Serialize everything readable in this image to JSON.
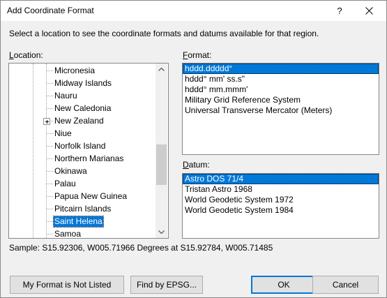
{
  "window": {
    "title": "Add Coordinate Format",
    "help_glyph": "?",
    "close_icon": "close-icon"
  },
  "instruction": "Select a location to see the coordinate formats and datums available for that region.",
  "location": {
    "label_prefix": "",
    "label_underlined": "L",
    "label_rest": "ocation:",
    "items": [
      {
        "label": "Micronesia",
        "expandable": false,
        "selected": false
      },
      {
        "label": "Midway Islands",
        "expandable": false,
        "selected": false
      },
      {
        "label": "Nauru",
        "expandable": false,
        "selected": false
      },
      {
        "label": "New Caledonia",
        "expandable": false,
        "selected": false
      },
      {
        "label": "New Zealand",
        "expandable": true,
        "selected": false
      },
      {
        "label": "Niue",
        "expandable": false,
        "selected": false
      },
      {
        "label": "Norfolk Island",
        "expandable": false,
        "selected": false
      },
      {
        "label": "Northern Marianas",
        "expandable": false,
        "selected": false
      },
      {
        "label": "Okinawa",
        "expandable": false,
        "selected": false
      },
      {
        "label": "Palau",
        "expandable": false,
        "selected": false
      },
      {
        "label": "Papua New Guinea",
        "expandable": false,
        "selected": false
      },
      {
        "label": "Pitcairn Islands",
        "expandable": false,
        "selected": false
      },
      {
        "label": "Saint Helena",
        "expandable": false,
        "selected": true
      },
      {
        "label": "Samoa",
        "expandable": false,
        "selected": false
      }
    ]
  },
  "format": {
    "label_underlined": "F",
    "label_rest": "ormat:",
    "items": [
      {
        "label": "hddd.ddddd°",
        "selected": true
      },
      {
        "label": "hddd° mm' ss.s\"",
        "selected": false
      },
      {
        "label": "hddd° mm.mmm'",
        "selected": false
      },
      {
        "label": "Military Grid Reference System",
        "selected": false
      },
      {
        "label": "Universal Transverse Mercator (Meters)",
        "selected": false
      }
    ]
  },
  "datum": {
    "label_underlined": "D",
    "label_rest": "atum:",
    "items": [
      {
        "label": "Astro DOS 71/4",
        "selected": true
      },
      {
        "label": "Tristan Astro 1968",
        "selected": false
      },
      {
        "label": "World Geodetic System 1972",
        "selected": false
      },
      {
        "label": "World Geodetic System 1984",
        "selected": false
      }
    ]
  },
  "sample": "Sample: S15.92306, W005.71966 Degrees at S15.92784, W005.71485",
  "buttons": {
    "not_listed": "My Format is Not Listed",
    "find_epsg": "Find by EPSG...",
    "ok": "OK",
    "cancel": "Cancel"
  },
  "colors": {
    "selection": "#0078d7",
    "dialog_bg": "#f0f0f0"
  }
}
